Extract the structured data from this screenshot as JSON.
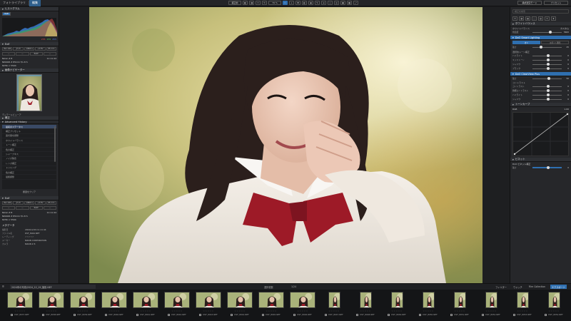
{
  "topbar": {
    "tabs": [
      "フォトライブラリ",
      "編集"
    ],
    "center_buttons": [
      "補正前",
      "◧",
      "◨",
      "▭",
      "↻",
      "79 %"
    ],
    "right_buttons": [
      "構成選定モード",
      "プリセット"
    ]
  },
  "left_panel": {
    "histogram_title": "ヒストグラム",
    "histogram_rgb": [
      "255",
      "255",
      "255"
    ],
    "exif_title": "Exif",
    "exif_buttons": [
      "ISO 100",
      "ƒ/1.8",
      "1/800 s",
      "+0 EV",
      "85 mm"
    ],
    "lens_row": [
      "—",
      "—",
      "RAW",
      "—"
    ],
    "camera": "Nikon Z 8",
    "lens": "NIKKOR Z 85mm f/1.8 S",
    "size": "8256 × 5504",
    "date": "2024/12/19",
    "time": "11:11:44",
    "navigator_title": "画像ナビゲーター",
    "navigator_zoom": "79 %",
    "detail_label": "ディテールビューア",
    "history_title": "補正",
    "history_subtitle": "Advanced History",
    "history_items": [
      "最初のステータス",
      "補正プリセット",
      "露光量を調整",
      "ホワイトバランス",
      "トーン補正",
      "色の補正",
      "シャープネス",
      "ノイズ除去",
      "レンズ補正",
      "トリミング",
      "色の補正",
      "最終調整"
    ],
    "history_footer": "履歴をクリア",
    "exif2_title": "Exif",
    "meta_title": "メタデータ",
    "meta": [
      {
        "k": "撮影日",
        "v": "2024/12/19 11:11:44"
      },
      {
        "k": "ファイル名",
        "v": "DSF_8044.NEF"
      },
      {
        "k": "レーティング",
        "v": "☆☆☆☆☆"
      },
      {
        "k": "メーカー",
        "v": "NIKON CORPORATION"
      },
      {
        "k": "カメラ",
        "v": "NIKON Z 8"
      },
      {
        "k": "レンズ",
        "v": "NIKKOR Z 85mm f/1.8 S"
      }
    ]
  },
  "right_panel": {
    "search_placeholder": "補正を検索",
    "wb_title": "DxO Smart Lighting",
    "wb_seg": [
      "オン",
      "スポット測光"
    ],
    "wb_label": "ホワイトバランス",
    "wb_value": "カスタム",
    "temp_label": "色温度",
    "temp_value": "5600",
    "light_label": "強さ",
    "light_value": "25",
    "sel_tone_title": "選択的トーン補正",
    "sel_tone": [
      {
        "label": "ハイライト",
        "value": "0"
      },
      {
        "label": "ミッドトーン",
        "value": "0"
      },
      {
        "label": "シャドウ",
        "value": "0"
      },
      {
        "label": "ブラック",
        "value": "0"
      }
    ],
    "clearview_title": "DxO ClearView Plus",
    "clearview_value": "50",
    "contrast_title": "コントラスト",
    "contrast": [
      {
        "label": "コントラスト",
        "value": "0"
      },
      {
        "label": "微細コントラスト",
        "value": "0"
      },
      {
        "label": "ハイライト",
        "value": "0"
      },
      {
        "label": "シャドウ",
        "value": "0"
      }
    ],
    "curve_title": "トーンカーブ",
    "curve_channel": "RGB",
    "curve_gamma": "1.00",
    "vignette_title": "ビネット",
    "vignette_value": "0",
    "vignette_mode": "DxO ビネット補正"
  },
  "filmstrip": {
    "path": "2024年の写真/2024_12_19_撮影.NEF",
    "count_left": "選択枚数",
    "count_right": "1/24",
    "fr_buttons": [
      "フィルター",
      "ウォッチ",
      "Film Collection"
    ],
    "fr_active": "エクスポート",
    "items": [
      {
        "name": "DSF_8037.NEF",
        "portrait": false
      },
      {
        "name": "DSF_8038.NEF",
        "portrait": false
      },
      {
        "name": "DSF_8039.NEF",
        "portrait": false
      },
      {
        "name": "DSF_8040.NEF",
        "portrait": false
      },
      {
        "name": "DSF_8041.NEF",
        "portrait": false
      },
      {
        "name": "DSF_8042.NEF",
        "portrait": false
      },
      {
        "name": "DSF_8043.NEF",
        "portrait": false
      },
      {
        "name": "DSF_8044.NEF",
        "portrait": false
      },
      {
        "name": "DSF_8045.NEF",
        "portrait": false
      },
      {
        "name": "DSF_8046.NEF",
        "portrait": false
      },
      {
        "name": "DSF_8047.NEF",
        "portrait": true
      },
      {
        "name": "DSF_8048.NEF",
        "portrait": true
      },
      {
        "name": "DSF_8049.NEF",
        "portrait": true
      },
      {
        "name": "DSF_8050.NEF",
        "portrait": true
      },
      {
        "name": "DSF_8051.NEF",
        "portrait": true
      },
      {
        "name": "DSF_8052.NEF",
        "portrait": true
      },
      {
        "name": "DSF_8053.NEF",
        "portrait": true
      },
      {
        "name": "DSF_8054.NEF",
        "portrait": true
      }
    ]
  },
  "colors": {
    "accent": "#2f6fb0",
    "panel": "#26272a",
    "background": "#1b1c1e"
  }
}
